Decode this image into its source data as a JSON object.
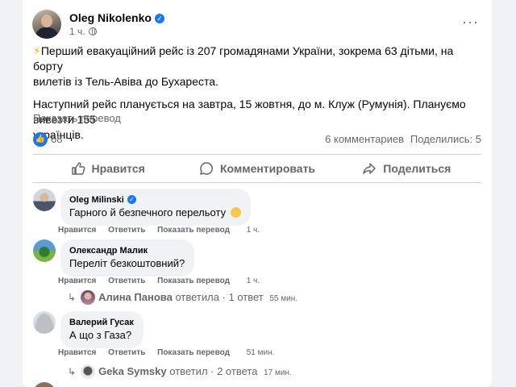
{
  "post": {
    "author": "Oleg Nikolenko",
    "time": "1 ч.",
    "paragraph1": "Перший евакуаційний рейс із 207 громадянами України, зокрема 63 дітьми, на борту вилетів із Тель-Авіва до Бухареста.",
    "paragraph1_line1": "Перший евакуаційний рейс із 207 громадянами України, зокрема 63 дітьми, на борту",
    "paragraph1_line2": "вилетів із Тель-Авіва до Бухареста.",
    "paragraph2_line1": "Наступний рейс планується на завтра, 15 жовтня, до м. Клуж (Румунія). Плануємо вивезти 155",
    "paragraph2_line2": "українців.",
    "translate": "Показать перевод",
    "likes": "68",
    "comments_count": "6 комментариев",
    "shares_count": "Поделились: 5"
  },
  "actions": {
    "like": "Нравится",
    "comment": "Комментировать",
    "share": "Поделиться"
  },
  "comment_actions": {
    "like": "Нравится",
    "reply": "Ответить",
    "translate": "Показать перевод"
  },
  "comments": [
    {
      "name": "Oleg Milinski",
      "text": "Гарного й безпечного перельоту",
      "time": "1 ч."
    },
    {
      "name": "Олександр Малик",
      "text": "Переліт безкоштовний?",
      "time": "1 ч.",
      "reply": {
        "name": "Алина Панова",
        "label": "ответила · 1 ответ",
        "time": "55 мин."
      }
    },
    {
      "name": "Валерий Гусак",
      "text": "А що з Газа?",
      "time": "51 мин.",
      "reply": {
        "name": "Geka Symsky",
        "label": "ответил · 2 ответа",
        "time": "17 мин."
      }
    }
  ],
  "colors": {
    "accent": "#1877f2",
    "muted": "#65676b",
    "bubble": "#f0f2f5"
  }
}
